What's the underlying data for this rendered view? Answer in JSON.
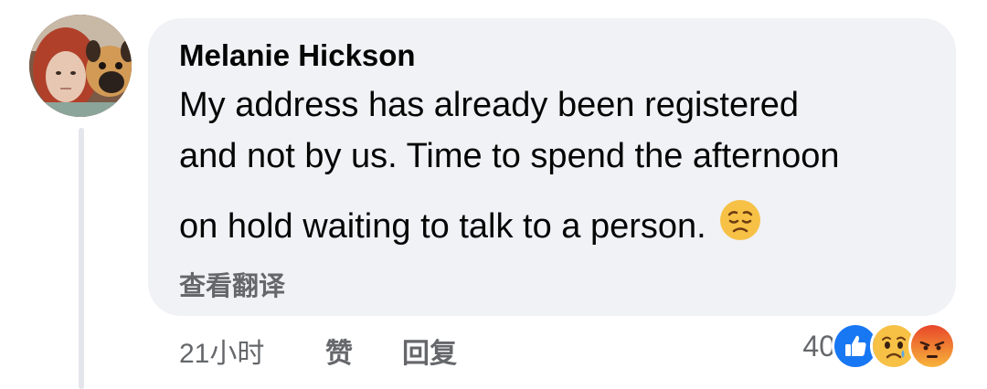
{
  "comment": {
    "author": "Melanie Hickson",
    "lines": [
      "My address has already been registered",
      "and not by us. Time to spend the afternoon",
      "on hold waiting to talk to a person."
    ],
    "inline_emoji": "disappointed-face",
    "translate_label": "查看翻译"
  },
  "meta": {
    "time": "21小时",
    "like_label": "赞",
    "reply_label": "回复"
  },
  "reactions": {
    "count": "40",
    "types": [
      "like",
      "sad",
      "angry"
    ]
  },
  "colors": {
    "bubble": "#f0f2f5",
    "secondary_text": "#65676b",
    "like_blue": "#1877f2",
    "thread_line": "#e4e6eb"
  }
}
